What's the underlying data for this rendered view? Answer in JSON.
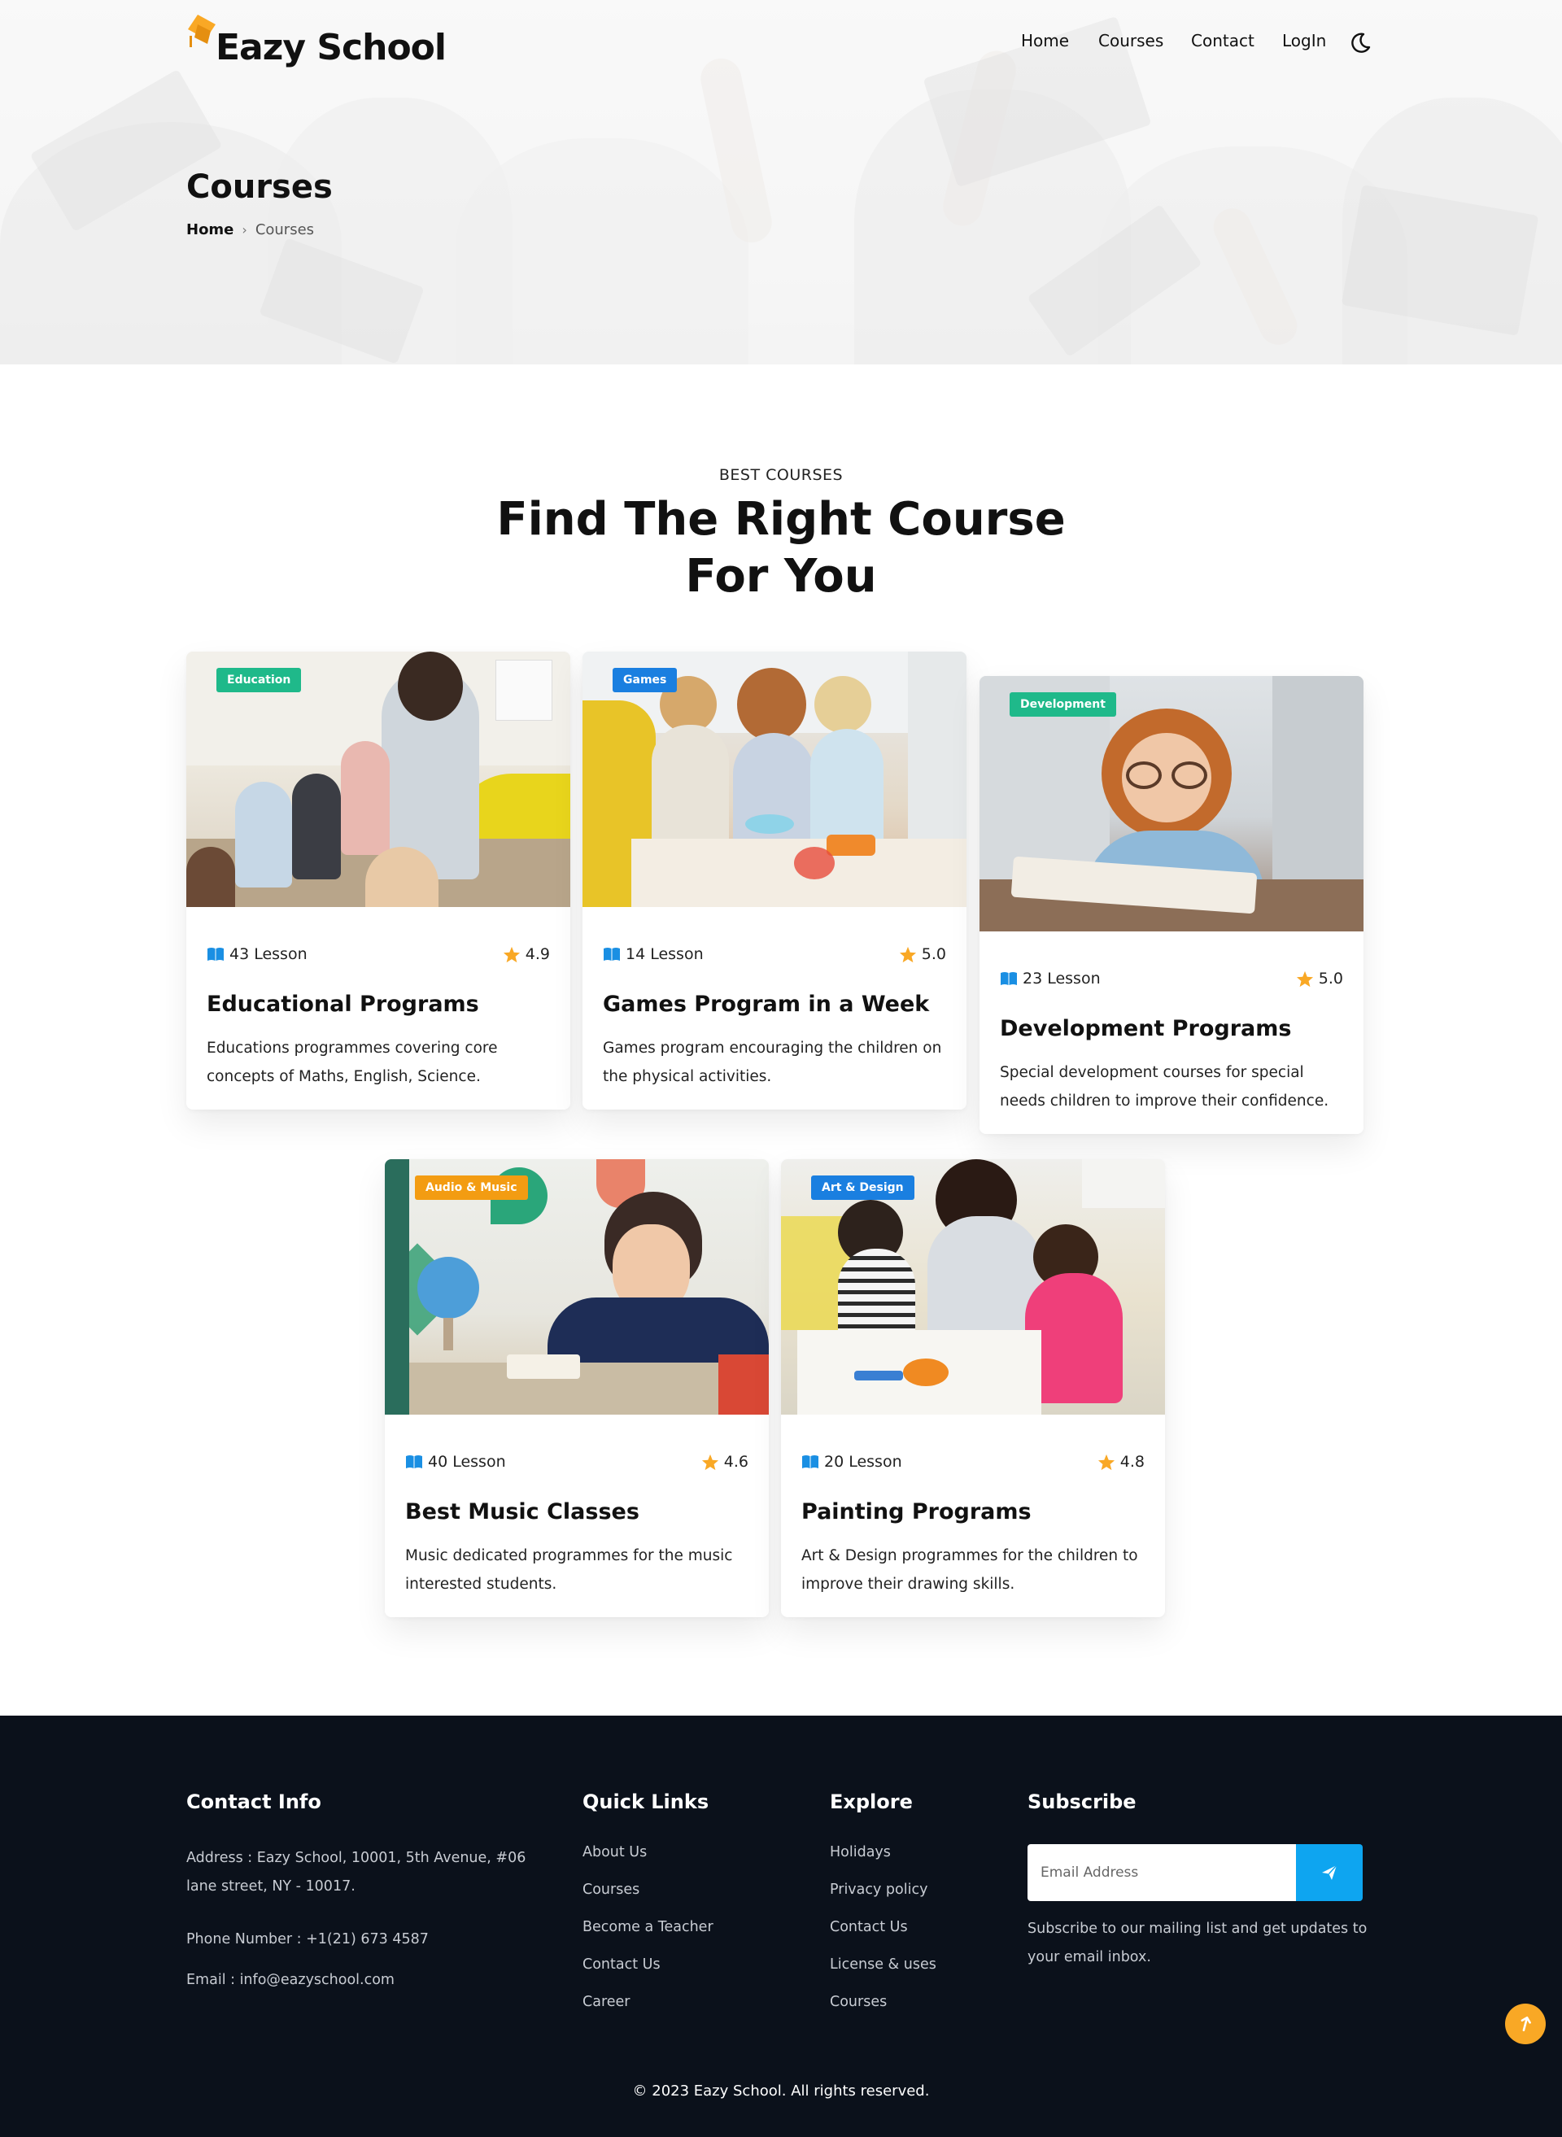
{
  "brand": {
    "name": "Eazy School",
    "accent": "#f9a825"
  },
  "nav": {
    "home": "Home",
    "courses": "Courses",
    "contact": "Contact",
    "login": "LogIn"
  },
  "hero": {
    "title": "Courses",
    "breadcrumb_home": "Home",
    "breadcrumb_current": "Courses"
  },
  "section": {
    "eyebrow": "BEST COURSES",
    "title": "Find The Right Course For You"
  },
  "courses": [
    {
      "badge": "Education",
      "badge_color": "#1fb98a",
      "lessons": "43 Lesson",
      "rating": "4.9",
      "title": "Educational Programs",
      "desc": "Educations programmes covering core concepts of Maths, English, Science."
    },
    {
      "badge": "Games",
      "badge_color": "#1a7fe0",
      "lessons": "14 Lesson",
      "rating": "5.0",
      "title": "Games Program in a Week",
      "desc": "Games program encouraging the children on the physical activities."
    },
    {
      "badge": "Development",
      "badge_color": "#1fb98a",
      "lessons": "23 Lesson",
      "rating": "5.0",
      "title": "Development Programs",
      "desc": "Special development courses for special needs children to improve their confidence."
    },
    {
      "badge": "Audio & Music",
      "badge_color": "#f39c12",
      "lessons": "40 Lesson",
      "rating": "4.6",
      "title": "Best Music Classes",
      "desc": "Music dedicated programmes for the music interested students."
    },
    {
      "badge": "Art & Design",
      "badge_color": "#1a7fe0",
      "lessons": "20 Lesson",
      "rating": "4.8",
      "title": "Painting Programs",
      "desc": "Art & Design programmes for the children to improve their drawing skills."
    }
  ],
  "footer": {
    "contact": {
      "heading": "Contact Info",
      "address": "Address : Eazy School, 10001, 5th Avenue, #06 lane street, NY - 10017.",
      "phone": "Phone Number : +1(21) 673 4587",
      "email": "Email : info@eazyschool.com"
    },
    "quick_links": {
      "heading": "Quick Links",
      "items": [
        "About Us",
        "Courses",
        "Become a Teacher",
        "Contact Us",
        "Career"
      ]
    },
    "explore": {
      "heading": "Explore",
      "items": [
        "Holidays",
        "Privacy policy",
        "Contact Us",
        "License & uses",
        "Courses"
      ]
    },
    "subscribe": {
      "heading": "Subscribe",
      "placeholder": "Email Address",
      "note": "Subscribe to our mailing list and get updates to your email inbox."
    },
    "copyright": "© 2023 Eazy School. All rights reserved."
  }
}
